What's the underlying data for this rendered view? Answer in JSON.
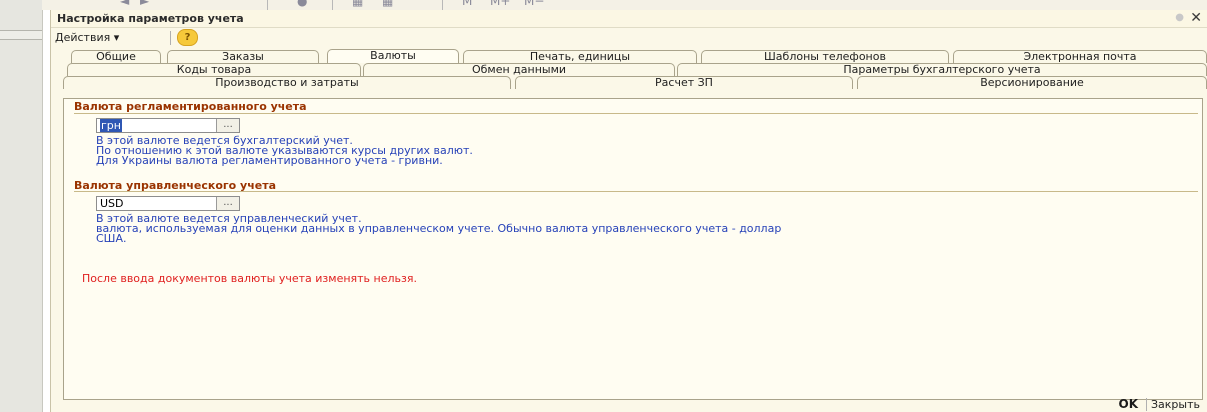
{
  "dialog": {
    "title": "Настройка параметров учета",
    "actions_label": "Действия ▾",
    "help_label": "?"
  },
  "tabs": {
    "row1": [
      "Общие",
      "Заказы",
      "Валюты",
      "Печать, единицы",
      "Шаблоны телефонов",
      "Электронная почта"
    ],
    "row2": [
      "Коды товара",
      "Обмен данными",
      "Параметры бухгалтерского учета"
    ],
    "row3": [
      "Производство и затраты",
      "Расчет ЗП",
      "Версионирование"
    ],
    "active": "Валюты"
  },
  "regulated": {
    "title": "Валюта регламентированного учета",
    "value": "грн",
    "info": [
      "В этой валюте ведется бухгалтерский учет.",
      "По отношению к этой валюте указываются курсы других валют.",
      "Для Украины валюта регламентированного учета - гривни."
    ]
  },
  "management": {
    "title": "Валюта управленческого учета",
    "value": "USD",
    "info": [
      "В этой валюте ведется управленческий учет.",
      "валюта, используемая для оценки данных в управленческом учете. Обычно валюта управленческого учета - доллар",
      "США."
    ]
  },
  "warning": "После ввода документов валюты учета изменять нельзя.",
  "buttons": {
    "ok": "OK",
    "close": "Закрыть",
    "select": "..."
  },
  "colors": {
    "group_title": "#9a3300",
    "info_text": "#2742b8",
    "warning_text": "#e02020"
  }
}
